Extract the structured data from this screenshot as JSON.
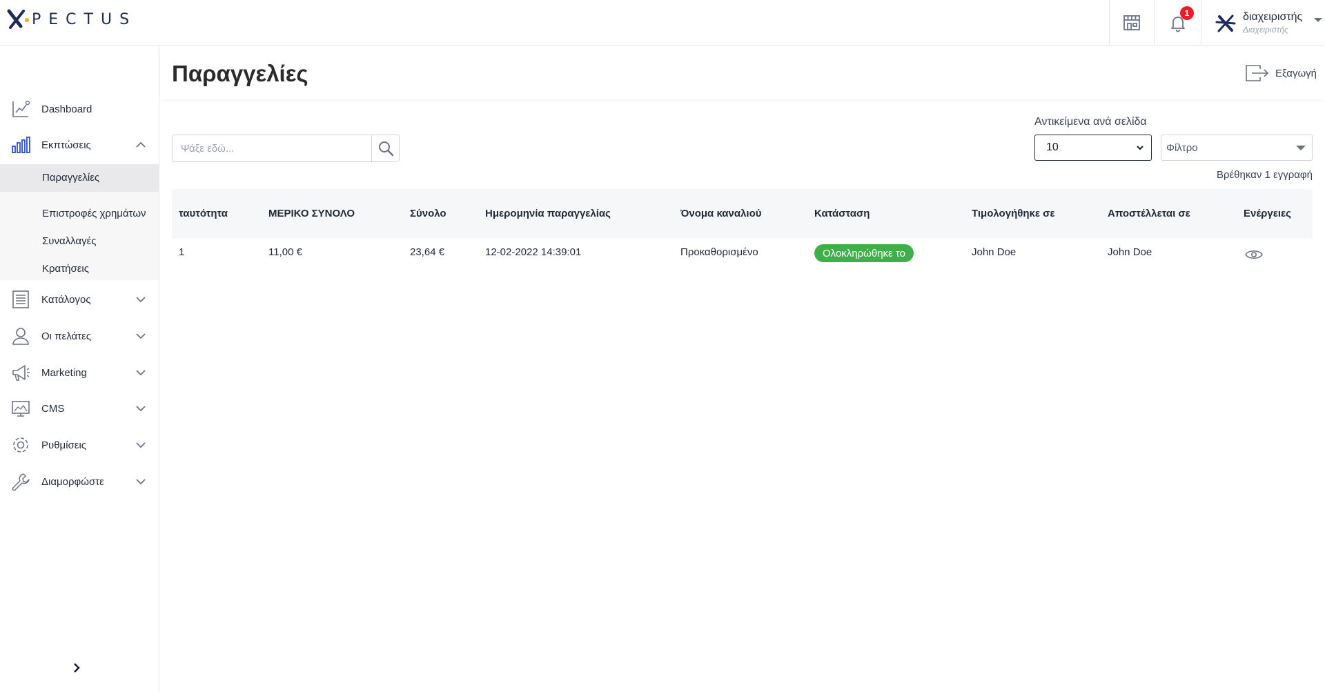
{
  "header": {
    "logo_text": "PECTUS",
    "notification_count": "1",
    "user_name": "διαχειριστής",
    "user_role": "Διαχειριστής"
  },
  "sidebar": {
    "items": [
      {
        "label": "Dashboard",
        "icon": "chart-line-icon"
      },
      {
        "label": "Εκπτώσεις",
        "icon": "bar-chart-icon",
        "expanded": true
      },
      {
        "label": "Κατάλογος",
        "icon": "list-icon"
      },
      {
        "label": "Οι πελάτες",
        "icon": "user-icon"
      },
      {
        "label": "Marketing",
        "icon": "megaphone-icon"
      },
      {
        "label": "CMS",
        "icon": "monitor-icon"
      },
      {
        "label": "Ρυθμίσεις",
        "icon": "gear-icon"
      },
      {
        "label": "Διαμορφώστε",
        "icon": "wrench-icon"
      }
    ],
    "subitems": [
      {
        "label": "Παραγγελίες",
        "active": true
      },
      {
        "label": "Επιστροφές χρημάτων"
      },
      {
        "label": "Συναλλαγές"
      },
      {
        "label": "Κρατήσεις"
      }
    ]
  },
  "main": {
    "title": "Παραγγελίες",
    "export_label": "Εξαγωγή",
    "search_placeholder": "Ψάξε εδώ...",
    "per_page_label": "Αντικείμενα ανά σελίδα",
    "per_page_value": "10",
    "filter_label": "Φίλτρο",
    "records_found": "Βρέθηκαν 1 εγγραφή"
  },
  "table": {
    "columns": [
      "ταυτότητα",
      "ΜΕΡΙΚΟ ΣΥΝΟΛΟ",
      "Σύνολο",
      "Ημερομηνία παραγγελίας",
      "Όνομα καναλιού",
      "Κατάσταση",
      "Τιμολογήθηκε σε",
      "Αποστέλλεται σε",
      "Ενέργειες"
    ],
    "rows": [
      {
        "id": "1",
        "subtotal": "11,00 €",
        "total": "23,64 €",
        "date": "12-02-2022 14:39:01",
        "channel": "Προκαθορισμένο",
        "status": "Ολοκληρώθηκε το",
        "billed_to": "John Doe",
        "shipped_to": "John Doe"
      }
    ]
  },
  "colors": {
    "status_completed": "#3eb04a",
    "badge": "#ef1c26",
    "brand_navy": "#1e2a5a",
    "brand_orange": "#f5a623",
    "icon_blue": "#2f4fbf"
  }
}
